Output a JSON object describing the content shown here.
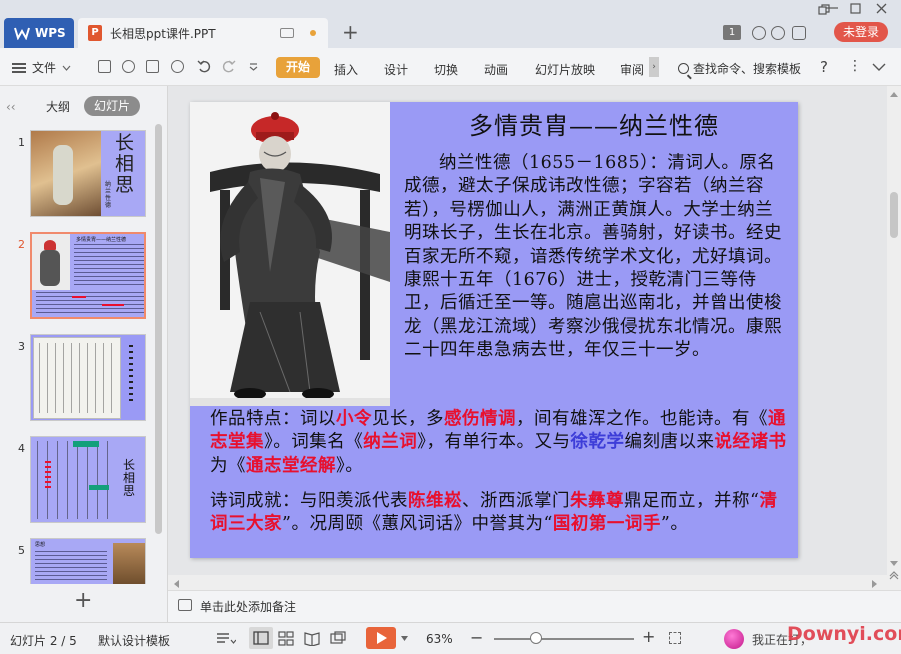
{
  "titlebar": {
    "app_tab": "WPS",
    "doc_tab_icon": "P",
    "doc_tab_title": "长相思ppt课件.PPT",
    "new_tab": "+",
    "window_badge": "1",
    "login_label": "未登录"
  },
  "toolbar": {
    "file_label": "文件",
    "start_label": "开始",
    "tabs": [
      "插入",
      "设计",
      "切换",
      "动画",
      "幻灯片放映",
      "审阅"
    ],
    "more_label": "›",
    "search_label": "查找命令、搜索模板",
    "help_label": "?",
    "menu_dots": "⋮",
    "collapse_chevron": "⌄"
  },
  "leftpanel": {
    "collapse_label": "‹‹",
    "outline_tab": "大纲",
    "slides_tab": "幻灯片",
    "thumbnails": [
      {
        "num": "1",
        "title": "长相思",
        "subtitle": "纳兰性德"
      },
      {
        "num": "2",
        "title": "多情贵胄——纳兰性德"
      },
      {
        "num": "3"
      },
      {
        "num": "4",
        "title": "长相思"
      },
      {
        "num": "5",
        "title": "思想"
      }
    ],
    "add_slide": "+"
  },
  "slide": {
    "title": "多情贵胄——纳兰性德",
    "bio": "纳兰性德（1655－1685）：清词人。原名成德，避太子保成讳改性德；字容若（纳兰容若），号楞伽山人，满洲正黄旗人。大学士纳兰明珠长子，生长在北京。善骑射，好读书。经史百家无所不窥，谙悉传统学术文化，尤好填词。康熙十五年（1676）进士，授乾清门三等侍卫，后循迁至一等。随扈出巡南北，并曾出使梭龙（黑龙江流域）考察沙俄侵扰东北情况。康熙二十四年患急病去世，年仅三十一岁。",
    "features": {
      "t1": "作品特点：词以",
      "r1": "小令",
      "t2": "见长，多",
      "r2": "感伤情调",
      "t3": "，间有雄浑之作。也能诗。有《",
      "r3": "通志堂集",
      "t4": "》。词集名《",
      "r4": "纳兰词",
      "t5": "》，有单行本。又与",
      "b1": "徐乾学",
      "t6": "编刻唐以来",
      "r5": "说经诸书",
      "t7": "为《",
      "r6": "通志堂经解",
      "t8": "》。"
    },
    "achievement": {
      "t1": "诗词成就：与阳羡派代表",
      "r1": "陈维崧",
      "t2": "、浙西派掌门",
      "r2": "朱彝尊",
      "t3": "鼎足而立，并称“",
      "r3": "清词三大家",
      "t4": "”。况周颐《蕙风词话》中誉其为“",
      "r4": "国初第一词手",
      "t5": "”。"
    }
  },
  "notes": {
    "placeholder": "单击此处添加备注"
  },
  "statusbar": {
    "slide_count": "幻灯片 2 / 5",
    "template": "默认设计模板",
    "zoom": "63%",
    "zoom_minus": "−",
    "zoom_plus": "+",
    "zoom_level_percent": 63,
    "message": "我正在打，"
  },
  "watermark": "Downyi.com",
  "colors": {
    "slide_bg": "#9a9af5",
    "accent_orange": "#e8a23a",
    "highlight_red": "#e8102e",
    "highlight_blue": "#3d3dd8",
    "login_red": "#e2564a",
    "wps_blue": "#2f5fb3"
  }
}
